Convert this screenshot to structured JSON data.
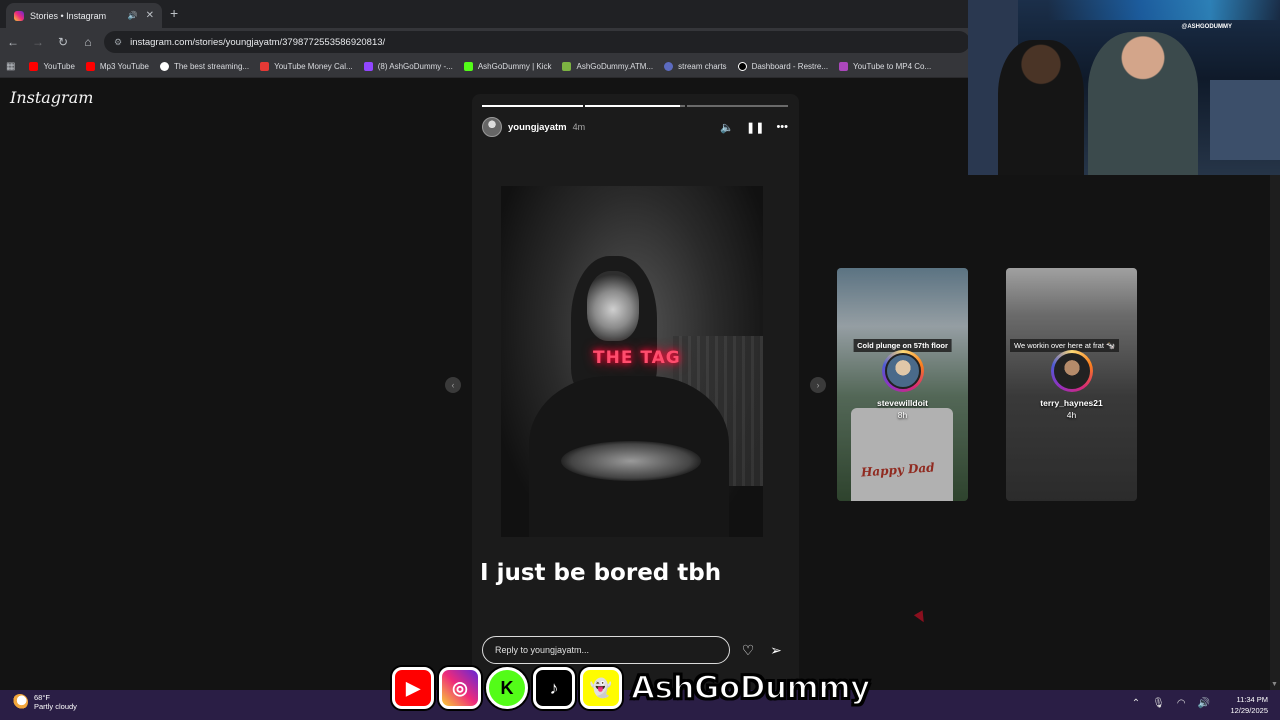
{
  "browser": {
    "tab_title": "Stories • Instagram",
    "url": "instagram.com/stories/youngjayatm/3798772553586920813/",
    "bookmarks": [
      {
        "label": "YouTube",
        "color": "#ff0000"
      },
      {
        "label": "Mp3 YouTube",
        "color": "#ff0000"
      },
      {
        "label": "The best streaming...",
        "color": "#ffffff"
      },
      {
        "label": "YouTube Money Cal...",
        "color": "#e53935"
      },
      {
        "label": "(8) AshGoDummy -...",
        "color": "#9146ff"
      },
      {
        "label": "AshGoDummy | Kick",
        "color": "#53fc18"
      },
      {
        "label": "AshGoDummy.ATM...",
        "color": "#7cb342"
      },
      {
        "label": "stream charts",
        "color": "#5c6bc0"
      },
      {
        "label": "Dashboard - Restre...",
        "color": "#000000"
      },
      {
        "label": "YouTube to MP4 Co...",
        "color": "#ab47bc"
      }
    ]
  },
  "instagram": {
    "logo": "Instagram",
    "story": {
      "username": "youngjayatm",
      "time": "4m",
      "overlay_text": "THE TAG",
      "caption": "I just be bored tbh",
      "reply_placeholder": "Reply to youngjayatm..."
    },
    "previews": [
      {
        "banner": "Cold plunge on 57th floor",
        "username": "stevewilldoit",
        "time": "8h",
        "mug_text": "Happy Dad"
      },
      {
        "banner": "We workin over here at frat 🐄",
        "username": "terry_haynes21",
        "time": "4h"
      }
    ]
  },
  "stream": {
    "channel_name": "AshGoDummy",
    "cam_tag": "@ASHGODUMMY"
  },
  "taskbar": {
    "temperature": "68°F",
    "weather": "Partly cloudy",
    "time": "11:34 PM",
    "date": "12/29/2025"
  }
}
